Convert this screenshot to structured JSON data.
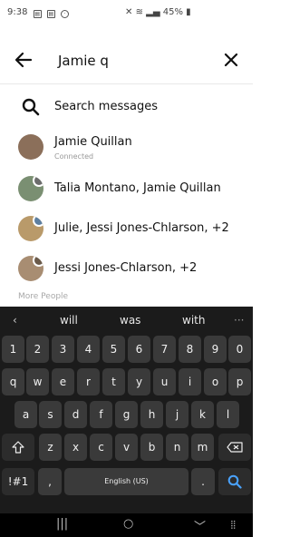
{
  "status": {
    "time": "9:38",
    "battery": "45%"
  },
  "search": {
    "query": "Jamie q"
  },
  "results": [
    {
      "label": "Search messages"
    },
    {
      "label": "Jamie Quillan",
      "sub": "Connected"
    },
    {
      "label": "Talia Montano, Jamie Quillan"
    },
    {
      "label": "Julie, Jessi Jones-Chlarson, +2"
    },
    {
      "label": "Jessi Jones-Chlarson, +2"
    }
  ],
  "more_people_label": "More People",
  "keyboard": {
    "suggestions": [
      "will",
      "was",
      "with"
    ],
    "num_row": [
      "1",
      "2",
      "3",
      "4",
      "5",
      "6",
      "7",
      "8",
      "9",
      "0"
    ],
    "row1": [
      "q",
      "w",
      "e",
      "r",
      "t",
      "y",
      "u",
      "i",
      "o",
      "p"
    ],
    "row2": [
      "a",
      "s",
      "d",
      "f",
      "g",
      "h",
      "j",
      "k",
      "l"
    ],
    "row3": [
      "z",
      "x",
      "c",
      "v",
      "b",
      "n",
      "m"
    ],
    "symbols_label": "!#1",
    "comma": ",",
    "space_label": "English (US)",
    "period": "."
  },
  "icons": {
    "back": "arrow-left-icon",
    "close": "close-icon",
    "search": "search-icon",
    "shift": "shift-icon",
    "backspace": "backspace-icon",
    "enter": "search-icon"
  }
}
